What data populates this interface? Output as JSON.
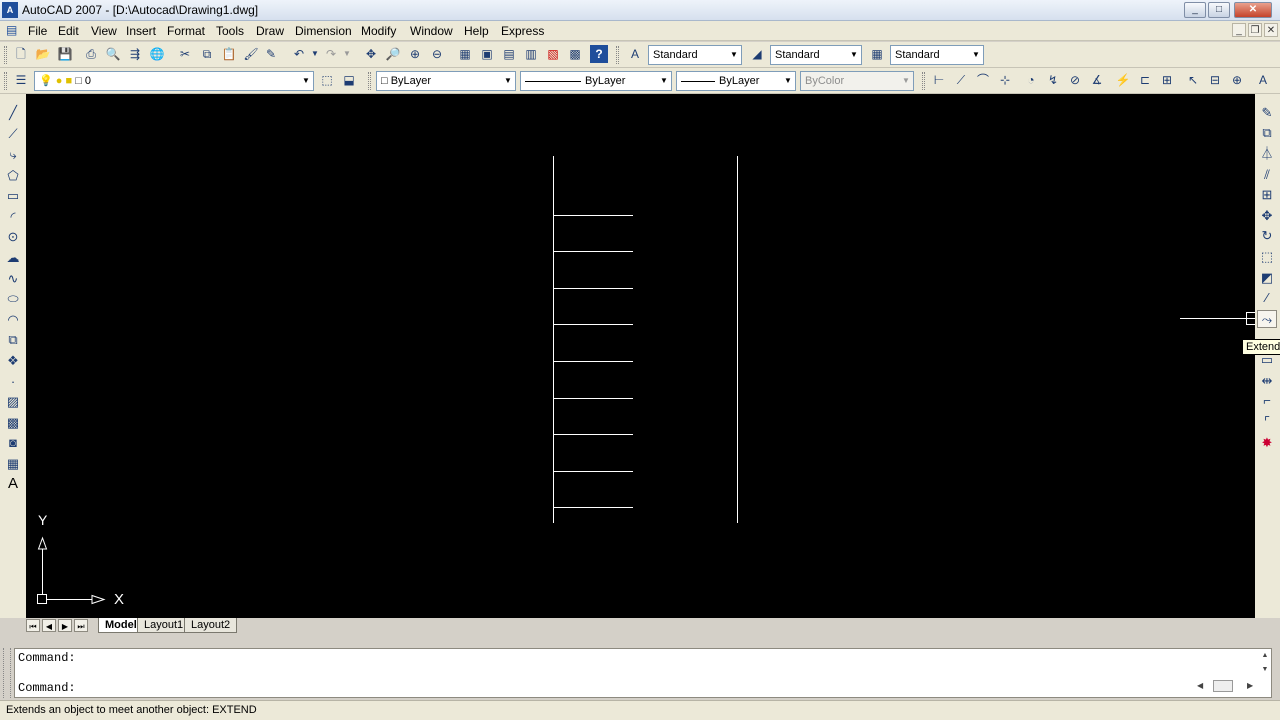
{
  "window": {
    "app_icon": "A",
    "title": "AutoCAD 2007 - [D:\\Autocad\\Drawing1.dwg]",
    "minimize_label": "_",
    "maximize_label": "□",
    "close_label": "✕",
    "mdi_minimize": "_",
    "mdi_restore": "❐",
    "mdi_close": "✕"
  },
  "menu": {
    "items": [
      "File",
      "Edit",
      "View",
      "Insert",
      "Format",
      "Tools",
      "Draw",
      "Dimension",
      "Modify",
      "Window",
      "Help",
      "Express"
    ]
  },
  "standard_toolbar": {
    "text_style": "Standard",
    "dim_style": "Standard",
    "table_style": "Standard"
  },
  "layers_toolbar": {
    "current_layer": "0"
  },
  "properties_toolbar": {
    "color": "ByLayer",
    "linetype": "ByLayer",
    "lineweight": "ByLayer",
    "plot_style": "ByColor"
  },
  "canvas": {
    "ucs_y_label": "Y",
    "ucs_x_label": "X"
  },
  "layout_tabs": {
    "tabs": [
      "Model",
      "Layout1",
      "Layout2"
    ],
    "active": "Model"
  },
  "command": {
    "history_line": "Command:",
    "prompt_line": "Command:"
  },
  "status": {
    "text": "Extends an object to meet another object:  EXTEND"
  },
  "tooltip": {
    "text": "Extend"
  },
  "colors": {
    "canvas_bg": "#000000",
    "line_color": "#ffffff",
    "toolbar_bg": "#ece9d8"
  },
  "icons": {
    "left_toolbar": [
      "line-icon",
      "construction-line-icon",
      "polyline-icon",
      "polygon-icon",
      "rectangle-icon",
      "arc-icon",
      "circle-icon",
      "revision-cloud-icon",
      "spline-icon",
      "ellipse-icon",
      "ellipse-arc-icon",
      "insert-block-icon",
      "make-block-icon",
      "point-icon",
      "hatch-icon",
      "gradient-icon",
      "region-icon",
      "table-icon",
      "multiline-text-icon"
    ],
    "right_toolbar": [
      "erase-icon",
      "copy-icon",
      "mirror-icon",
      "offset-icon",
      "array-icon",
      "move-icon",
      "rotate-icon",
      "scale-icon",
      "stretch-icon",
      "trim-icon",
      "extend-icon",
      "break-at-point-icon",
      "break-icon",
      "join-icon",
      "chamfer-icon",
      "fillet-icon",
      "explode-icon"
    ]
  }
}
